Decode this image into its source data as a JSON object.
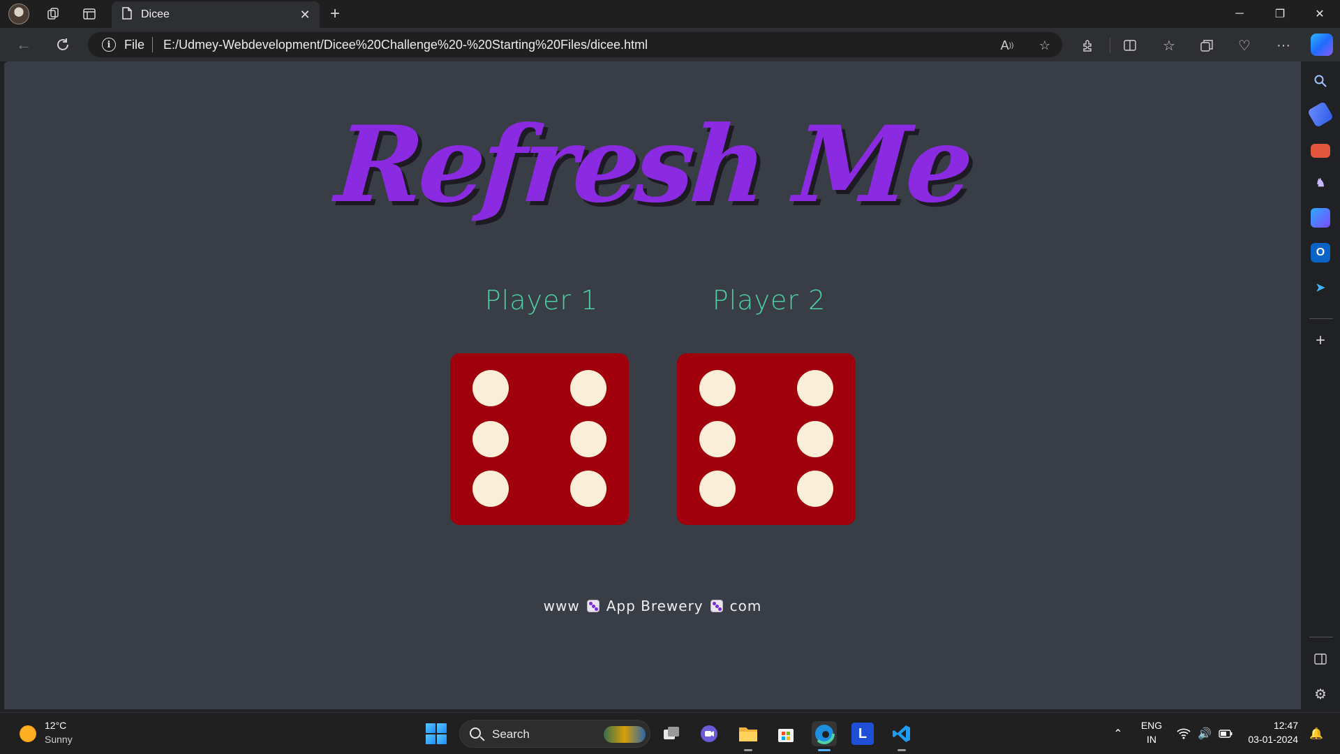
{
  "browser": {
    "tab_title": "Dicee",
    "new_tab_glyph": "+",
    "close_glyph": "✕",
    "minimize_glyph": "─",
    "restore_glyph": "❐",
    "window_close_glyph": "✕"
  },
  "address_bar": {
    "protocol_label": "File",
    "url": "E:/Udmey-Webdevelopment/Dicee%20Challenge%20-%20Starting%20Files/dicee.html"
  },
  "page": {
    "title": "Refresh Me",
    "players": [
      {
        "label": "Player 1",
        "dice_value": 6
      },
      {
        "label": "Player 2",
        "dice_value": 6
      }
    ],
    "footer": {
      "prefix": "www",
      "brand": "App Brewery",
      "suffix": "com"
    },
    "colors": {
      "background": "#393e46",
      "title": "#8a2be2",
      "player_label": "#4ecca3",
      "dice": "#a0000c",
      "pip": "#fbeed8"
    }
  },
  "sidebar_icons": [
    "search-icon",
    "shopping-tag-icon",
    "toolbox-icon",
    "chess-icon",
    "copilot-icon",
    "outlook-icon",
    "telegram-icon",
    "add-icon",
    "split-panel-icon",
    "settings-icon"
  ],
  "taskbar": {
    "weather_temp": "12°C",
    "weather_condition": "Sunny",
    "search_label": "Search",
    "language": "ENG",
    "region": "IN",
    "time": "12:47",
    "date": "03-01-2024"
  }
}
